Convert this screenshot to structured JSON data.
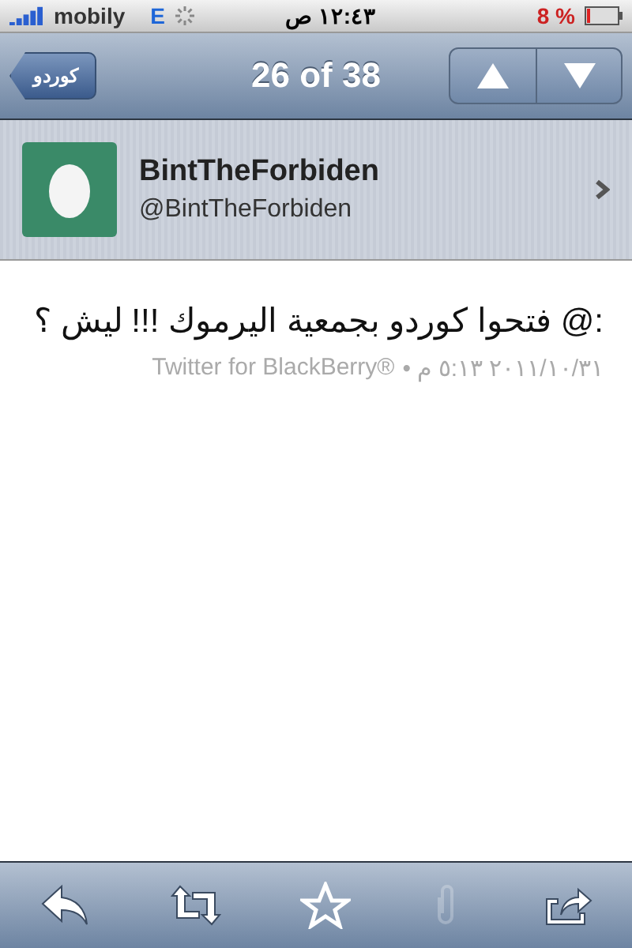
{
  "status_bar": {
    "carrier": "mobily",
    "network": "E",
    "time": "١٢:٤٣ ص",
    "battery": "8 %"
  },
  "nav_bar": {
    "back": "كوردو",
    "title": "26 of 38"
  },
  "profile": {
    "name": "BintTheForbiden",
    "handle": "@BintTheForbiden"
  },
  "tweet": {
    "text": ":@ فتحوا كوردو بجمعية اليرموك !!! ليش ؟",
    "date": "٢٠١١/١٠/٣١ ٥:١٣ م •",
    "source": "Twitter for BlackBerry®"
  },
  "toolbar": [
    {
      "kind": "reply",
      "disabled": false
    },
    {
      "kind": "retweet",
      "disabled": false
    },
    {
      "kind": "favorite",
      "disabled": false
    },
    {
      "kind": "attachment",
      "disabled": true
    },
    {
      "kind": "share",
      "disabled": false
    }
  ]
}
